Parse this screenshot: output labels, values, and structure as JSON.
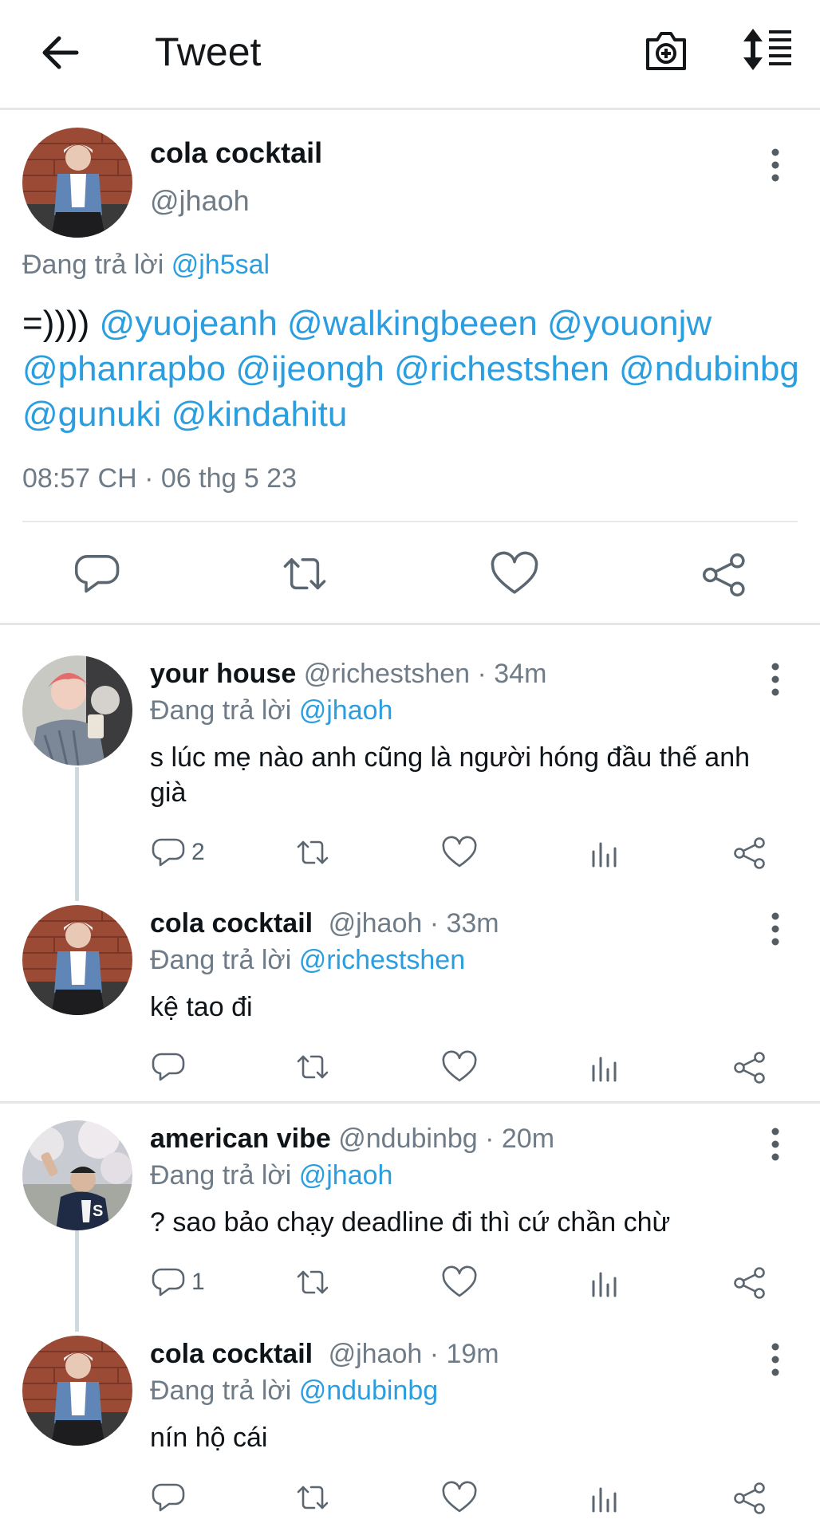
{
  "appbar": {
    "title": "Tweet",
    "icons": [
      "back-arrow-icon",
      "camera-plus-icon",
      "sort-icon"
    ]
  },
  "main_tweet": {
    "name": "cola cocktail",
    "handle": "@jhaoh",
    "replying_prefix": "Đang trả lời",
    "replying_to": "@jh5sal",
    "text_prefix": "=))))",
    "mentions": [
      "@yuojeanh",
      "@walkingbeeen",
      "@youonjw",
      "@phanrapbo",
      "@ijeongh",
      "@richestshen",
      "@ndubinbg",
      "@gunuki",
      "@kindahitu"
    ],
    "timestamp": "08:57 CH · 06 thg 5 23"
  },
  "replies": [
    {
      "name": "your house",
      "meta": "@richestshen · 34m",
      "replying_prefix": "Đang trả lời",
      "replying_to": "@jhaoh",
      "text": "s lúc mẹ nào anh cũng là người hóng đầu thế anh già",
      "reply_count": "2"
    },
    {
      "name": "cola cocktail",
      "meta": "@jhaoh · 33m",
      "replying_prefix": "Đang trả lời",
      "replying_to": "@richestshen",
      "text": "kệ tao đi",
      "reply_count": ""
    },
    {
      "name": "american vibe",
      "meta": "@ndubinbg · 20m",
      "replying_prefix": "Đang trả lời",
      "replying_to": "@jhaoh",
      "text": "? sao bảo chạy deadline đi thì cứ chần chừ",
      "reply_count": "1"
    },
    {
      "name": "cola cocktail",
      "meta": "@jhaoh · 19m",
      "replying_prefix": "Đang trả lời",
      "replying_to": "@ndubinbg",
      "text": "nín hộ cái",
      "reply_count": ""
    }
  ],
  "colors": {
    "link": "#2b9ee0",
    "secondary_text": "#6f7b86",
    "divider": "#e4e6e8"
  }
}
